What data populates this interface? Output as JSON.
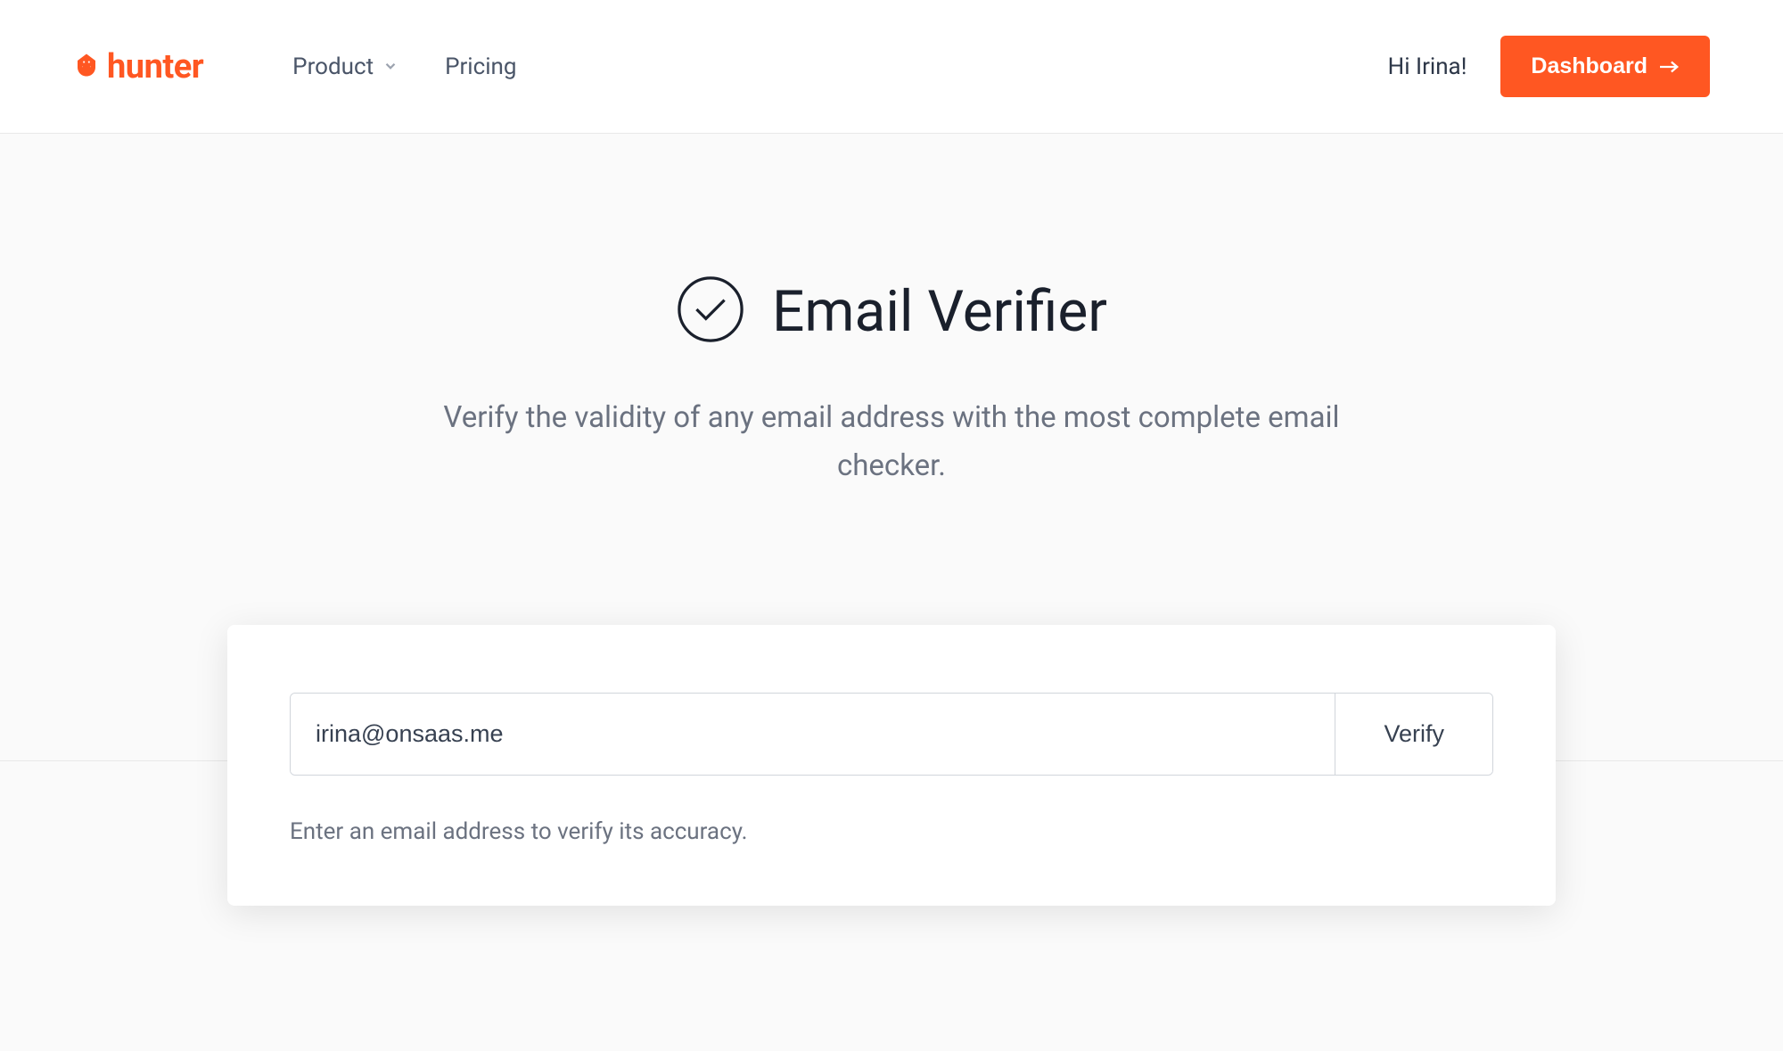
{
  "header": {
    "logo_text": "hunter",
    "nav": {
      "product": "Product",
      "pricing": "Pricing"
    },
    "greeting": "Hi Irina!",
    "dashboard_label": "Dashboard"
  },
  "hero": {
    "title": "Email Verifier",
    "subtitle": "Verify the validity of any email address with the most complete email checker."
  },
  "verifier": {
    "email_value": "irina@onsaas.me",
    "verify_label": "Verify",
    "help_text": "Enter an email address to verify its accuracy."
  },
  "colors": {
    "brand": "#ff5722"
  }
}
